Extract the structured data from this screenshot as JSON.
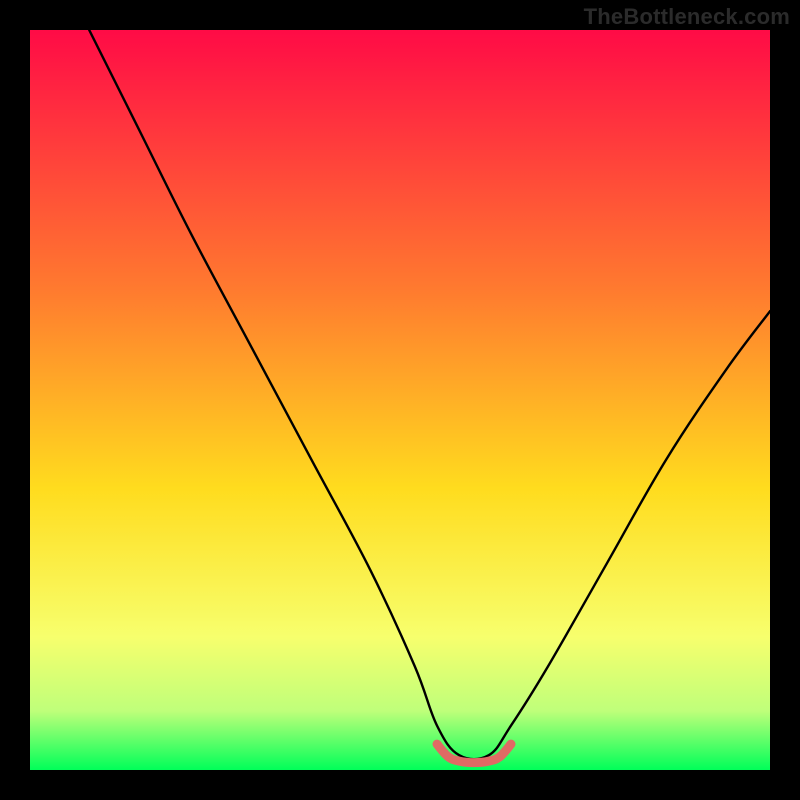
{
  "watermark": "TheBottleneck.com",
  "colors": {
    "black": "#000000",
    "curve": "#000000",
    "highlight": "#e06a64",
    "grad_top": "#ff0b46",
    "grad_mid1": "#ff7a2f",
    "grad_mid2": "#ffdc1e",
    "grad_mid3": "#f7ff6d",
    "grad_mid4": "#bfff7a",
    "grad_bottom": "#00ff59"
  },
  "chart_data": {
    "type": "line",
    "title": "",
    "xlabel": "",
    "ylabel": "",
    "xlim": [
      0,
      100
    ],
    "ylim": [
      0,
      100
    ],
    "notes": "V-shaped bottleneck curve over a vertical red→green gradient background; a small salmon segment sits at the valley floor between roughly x=55 and x=65.",
    "series": [
      {
        "name": "curve",
        "x": [
          8,
          15,
          22,
          30,
          38,
          46,
          52,
          55,
          58,
          62,
          65,
          70,
          78,
          86,
          94,
          100
        ],
        "y": [
          100,
          86,
          72,
          57,
          42,
          27,
          14,
          6,
          2,
          2,
          6,
          14,
          28,
          42,
          54,
          62
        ]
      },
      {
        "name": "valley-highlight",
        "x": [
          55,
          56.5,
          58,
          60,
          62,
          63.5,
          65
        ],
        "y": [
          3.5,
          1.8,
          1.2,
          1.0,
          1.2,
          1.8,
          3.5
        ]
      }
    ]
  }
}
